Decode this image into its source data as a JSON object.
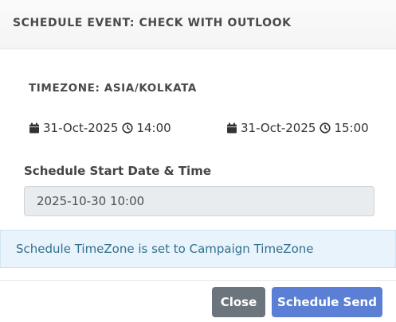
{
  "modal": {
    "title": "SCHEDULE EVENT: CHECK WITH OUTLOOK",
    "timezone_label": "TIMEZONE: ASIA/KOLKATA",
    "start": {
      "date": "31-Oct-2025",
      "time": "14:00",
      "date_icon": "calendar-icon",
      "time_icon": "clock-icon"
    },
    "end": {
      "date": "31-Oct-2025",
      "time": "15:00",
      "date_icon": "calendar-icon",
      "time_icon": "clock-icon"
    },
    "schedule_field": {
      "label": "Schedule Start Date & Time",
      "value": "2025-10-30 10:00"
    },
    "info_message": "Schedule TimeZone is set to Campaign TimeZone",
    "buttons": {
      "close_label": "Close",
      "send_label": "Schedule Send"
    },
    "colors": {
      "close_button": "#6c757d",
      "send_button": "#5b7fd4",
      "info_background": "#e8f3fb",
      "info_text": "#31708f"
    }
  }
}
